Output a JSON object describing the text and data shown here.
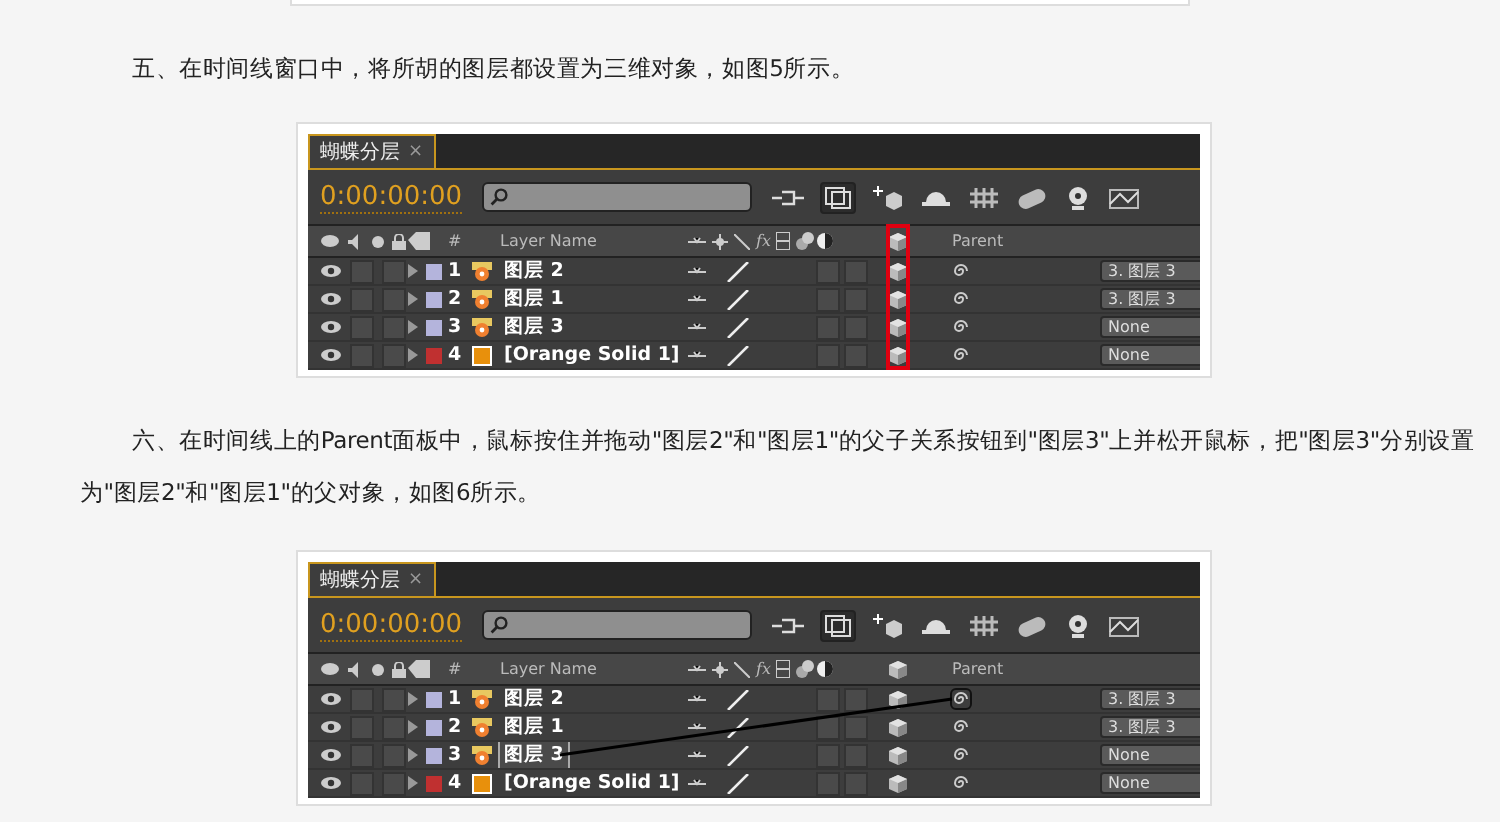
{
  "content": [
    {
      "kind": "frame"
    },
    {
      "kind": "paragraph",
      "text": "五、在时间线窗口中，将所胡的图层都设置为三维对象，如图5所示。"
    },
    {
      "kind": "timeline",
      "tab": "蝴蝶分层",
      "tab_close": "×",
      "timecode": "0:00:00:00",
      "headers": {
        "number": "#",
        "layer_name": "Layer Name",
        "fx": "fx",
        "parent": "Parent"
      },
      "highlight_3d_column": true,
      "rows": [
        {
          "number": "1",
          "name": "图层 2",
          "color": "#b4b4dc",
          "kind": "footage",
          "three_d": true,
          "parent": "3. 图层 3",
          "pick_whip_source": false,
          "drag_target": false
        },
        {
          "number": "2",
          "name": "图层 1",
          "color": "#b4b4dc",
          "kind": "footage",
          "three_d": true,
          "parent": "3. 图层 3",
          "pick_whip_source": false,
          "drag_target": false
        },
        {
          "number": "3",
          "name": "图层 3",
          "color": "#b4b4dc",
          "kind": "footage",
          "three_d": true,
          "parent": "None",
          "pick_whip_source": false,
          "drag_target": false
        },
        {
          "number": "4",
          "name": "[Orange Solid 1]",
          "color": "#c03030",
          "kind": "solid",
          "three_d": true,
          "parent": "None",
          "pick_whip_source": false,
          "drag_target": false
        }
      ]
    },
    {
      "kind": "paragraph",
      "text": "六、在时间线上的Parent面板中，鼠标按住并拖动\"图层2\"和\"图层1\"的父子关系按钮到\"图层3\"上并松开鼠标，把\"图层3\"分别设置为\"图层2\"和\"图层1\"的父对象，如图6所示。"
    },
    {
      "kind": "timeline",
      "tab": "蝴蝶分层",
      "tab_close": "×",
      "timecode": "0:00:00:00",
      "headers": {
        "number": "#",
        "layer_name": "Layer Name",
        "fx": "fx",
        "parent": "Parent"
      },
      "highlight_3d_column": false,
      "rows": [
        {
          "number": "1",
          "name": "图层 2",
          "color": "#b4b4dc",
          "kind": "footage",
          "three_d": true,
          "parent": "3. 图层 3",
          "pick_whip_source": true,
          "drag_target": false
        },
        {
          "number": "2",
          "name": "图层 1",
          "color": "#b4b4dc",
          "kind": "footage",
          "three_d": true,
          "parent": "3. 图层 3",
          "pick_whip_source": false,
          "drag_target": false
        },
        {
          "number": "3",
          "name": "图层 3",
          "color": "#b4b4dc",
          "kind": "footage",
          "three_d": true,
          "parent": "None",
          "pick_whip_source": false,
          "drag_target": true
        },
        {
          "number": "4",
          "name": "[Orange Solid 1]",
          "color": "#c03030",
          "kind": "solid",
          "three_d": true,
          "parent": "None",
          "pick_whip_source": false,
          "drag_target": false
        }
      ]
    }
  ]
}
